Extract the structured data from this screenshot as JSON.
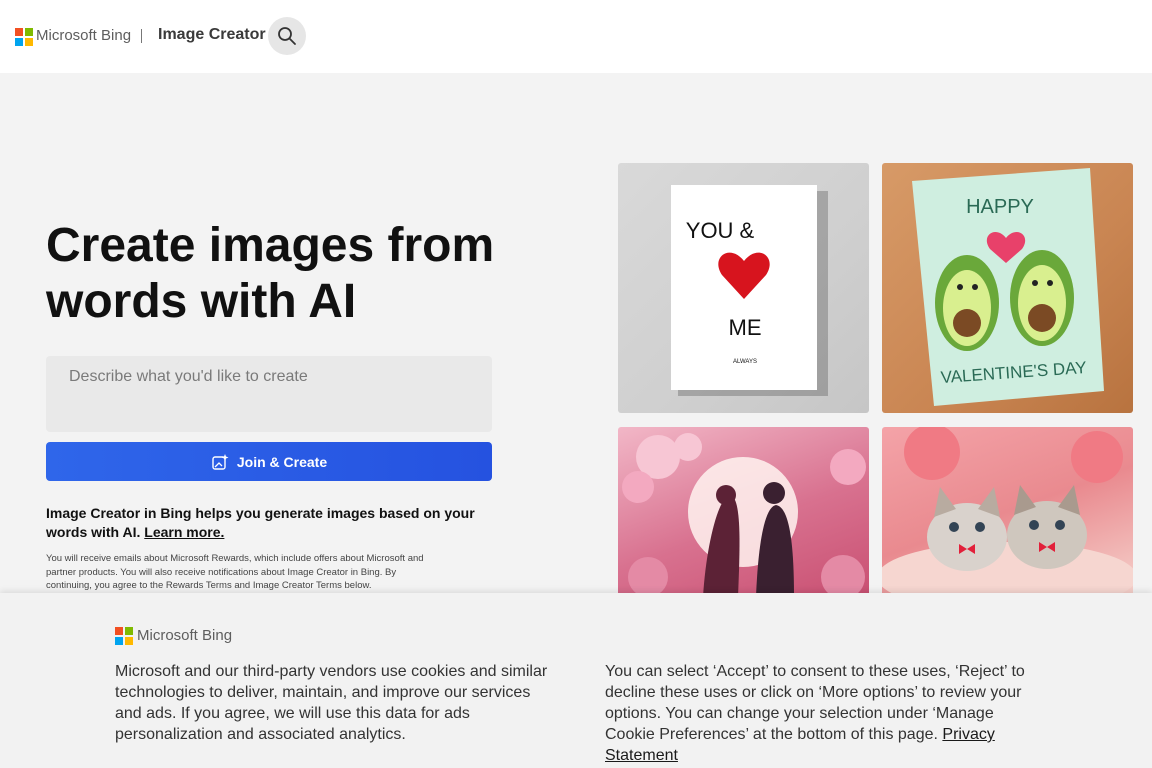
{
  "header": {
    "brand": "Microsoft Bing",
    "app_title": "Image Creator",
    "search_icon": "search-icon",
    "logo_colors": [
      "#f25022",
      "#7fba00",
      "#00a4ef",
      "#ffb900"
    ]
  },
  "hero": {
    "title": "Create images from words with AI",
    "prompt_placeholder": "Describe what you'd like to create",
    "join_button_label": "Join & Create",
    "join_icon": "sparkle-image-icon",
    "description": "Image Creator in Bing helps you generate images based on your words with AI.",
    "learn_more": "Learn more.",
    "fine_print": "You will receive emails about Microsoft Rewards, which include offers about Microsoft and partner products. You will also receive notifications about Image Creator in Bing. By continuing, you agree to the Rewards Terms and Image Creator Terms below.",
    "accent_color": "#2b5fe8"
  },
  "gallery": {
    "card1": {
      "line1": "YOU &",
      "line2": "ME",
      "line3": "ALWAYS"
    },
    "card2": {
      "top": "HAPPY",
      "bottom": "VALENTINE'S DAY"
    }
  },
  "cookie_banner": {
    "brand": "Microsoft Bing",
    "left_text": "Microsoft and our third-party vendors use cookies and similar technologies to deliver, maintain, and improve our services and ads. If you agree, we will use this data for ads personalization and associated analytics.",
    "right_text": "You can select ‘Accept’ to consent to these uses, ‘Reject’ to decline these uses or click on ‘More options’ to review your options. You can change your selection under ‘Manage Cookie Preferences’ at the bottom of this page.",
    "privacy_link": "Privacy Statement"
  }
}
